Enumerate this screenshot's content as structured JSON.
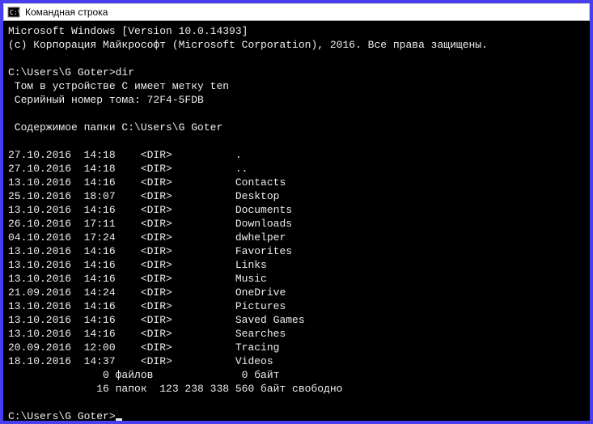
{
  "titlebar": {
    "title": "Командная строка"
  },
  "terminal": {
    "header_line1": "Microsoft Windows [Version 10.0.14393]",
    "header_line2": "(c) Корпорация Майкрософт (Microsoft Corporation), 2016. Все права защищены.",
    "prompt1": "C:\\Users\\G Goter>",
    "command1": "dir",
    "volume_line": " Том в устройстве C имеет метку ten",
    "serial_line": " Серийный номер тома: 72F4-5FDB",
    "contents_line": " Содержимое папки C:\\Users\\G Goter",
    "entries": [
      {
        "date": "27.10.2016",
        "time": "14:18",
        "type": "<DIR>",
        "name": "."
      },
      {
        "date": "27.10.2016",
        "time": "14:18",
        "type": "<DIR>",
        "name": ".."
      },
      {
        "date": "13.10.2016",
        "time": "14:16",
        "type": "<DIR>",
        "name": "Contacts"
      },
      {
        "date": "25.10.2016",
        "time": "18:07",
        "type": "<DIR>",
        "name": "Desktop"
      },
      {
        "date": "13.10.2016",
        "time": "14:16",
        "type": "<DIR>",
        "name": "Documents"
      },
      {
        "date": "26.10.2016",
        "time": "17:11",
        "type": "<DIR>",
        "name": "Downloads"
      },
      {
        "date": "04.10.2016",
        "time": "17:24",
        "type": "<DIR>",
        "name": "dwhelper"
      },
      {
        "date": "13.10.2016",
        "time": "14:16",
        "type": "<DIR>",
        "name": "Favorites"
      },
      {
        "date": "13.10.2016",
        "time": "14:16",
        "type": "<DIR>",
        "name": "Links"
      },
      {
        "date": "13.10.2016",
        "time": "14:16",
        "type": "<DIR>",
        "name": "Music"
      },
      {
        "date": "21.09.2016",
        "time": "14:24",
        "type": "<DIR>",
        "name": "OneDrive"
      },
      {
        "date": "13.10.2016",
        "time": "14:16",
        "type": "<DIR>",
        "name": "Pictures"
      },
      {
        "date": "13.10.2016",
        "time": "14:16",
        "type": "<DIR>",
        "name": "Saved Games"
      },
      {
        "date": "13.10.2016",
        "time": "14:16",
        "type": "<DIR>",
        "name": "Searches"
      },
      {
        "date": "20.09.2016",
        "time": "12:00",
        "type": "<DIR>",
        "name": "Tracing"
      },
      {
        "date": "18.10.2016",
        "time": "14:37",
        "type": "<DIR>",
        "name": "Videos"
      }
    ],
    "summary_files": "               0 файлов              0 байт",
    "summary_dirs": "              16 папок  123 238 338 560 байт свободно",
    "prompt2": "C:\\Users\\G Goter>"
  }
}
